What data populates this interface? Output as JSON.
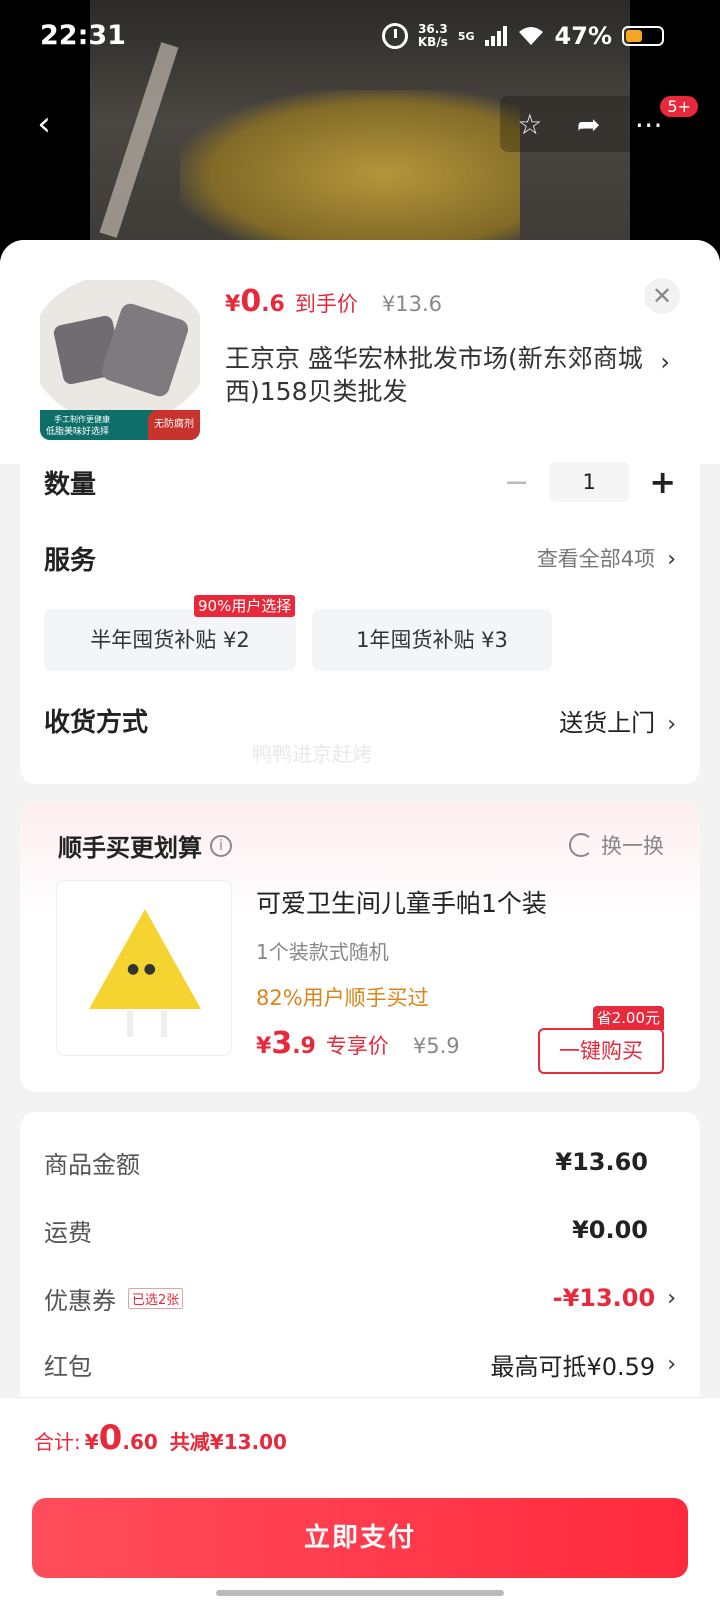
{
  "status_bar": {
    "time": "22:31",
    "net_speed_value": "36.3",
    "net_speed_unit": "KB/s",
    "network": "5G",
    "battery": "47%",
    "battery_level": 0.47
  },
  "nav": {
    "badge": "5+"
  },
  "product": {
    "price_currency": "¥",
    "price_int": "0",
    "price_dec": ".6",
    "price_label": "到手价",
    "original_price": "¥13.6",
    "shop": "王京京  盛华宏林批发市场(新东郊商城西)158贝类批发",
    "thumb_banner_line1": "手工制作更健康",
    "thumb_banner_line2": "低脂美味好选择",
    "thumb_tag": "无防腐剂"
  },
  "options": {
    "quantity_label": "数量",
    "quantity": "1",
    "service_label": "服务",
    "service_link": "查看全部4项",
    "service_chips": [
      {
        "label": "半年囤货补贴  ¥2",
        "tag": "90%用户选择"
      },
      {
        "label": "1年囤货补贴  ¥3"
      }
    ],
    "delivery_label": "收货方式",
    "delivery_value": "送货上门",
    "watermark": "鸭鸭进京赶烤"
  },
  "addon": {
    "title": "顺手买更划算",
    "refresh_label": "换一换",
    "name": "可爱卫生间儿童手帕1个装",
    "spec": "1个装款式随机",
    "popularity": "82%用户顺手买过",
    "price_currency": "¥",
    "price_int": "3",
    "price_dec": ".9",
    "price_label": "专享价",
    "original_price": "¥5.9",
    "save_tag": "省2.00元",
    "buy_label": "一键购买"
  },
  "summary": {
    "goods_label": "商品金额",
    "goods_value": "¥13.60",
    "shipping_label": "运费",
    "shipping_value": "¥0.00",
    "coupon_label": "优惠券",
    "coupon_tag": "已选2张",
    "coupon_value": "-¥13.00",
    "redpacket_label": "红包",
    "redpacket_value": "最高可抵¥0.59"
  },
  "footer": {
    "total_label": "合计:",
    "total_currency": "¥",
    "total_int": "0",
    "total_dec": ".60",
    "saved": "共减¥13.00",
    "pay_label": "立即支付"
  },
  "colors": {
    "accent": "#e8293b",
    "popularity": "#d9851c"
  }
}
